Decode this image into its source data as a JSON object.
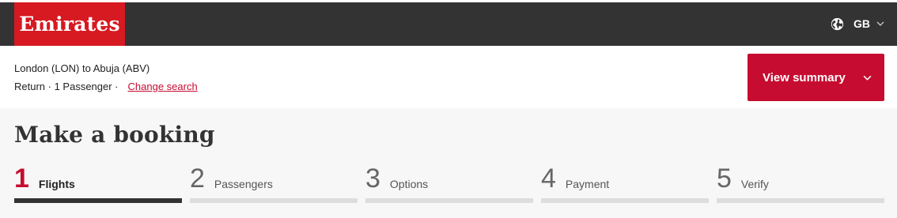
{
  "header": {
    "logo_text": "Emirates",
    "locale_code": "GB",
    "globe_icon": "globe-icon",
    "chevron_icon": "chevron-down-icon"
  },
  "search": {
    "route": "London (LON) to Abuja (ABV)",
    "trip_details": "Return · 1 Passenger ·",
    "change_link": "Change search",
    "summary_button": "View summary"
  },
  "booking": {
    "title": "Make a booking",
    "steps": [
      {
        "number": "1",
        "label": "Flights",
        "active": true
      },
      {
        "number": "2",
        "label": "Passengers",
        "active": false
      },
      {
        "number": "3",
        "label": "Options",
        "active": false
      },
      {
        "number": "4",
        "label": "Payment",
        "active": false
      },
      {
        "number": "5",
        "label": "Verify",
        "active": false
      }
    ]
  },
  "colors": {
    "brand_red": "#d71921",
    "accent_red": "#c60c30",
    "topbar": "#333333",
    "inactive_bar": "#dddddd",
    "active_bar": "#333333"
  }
}
